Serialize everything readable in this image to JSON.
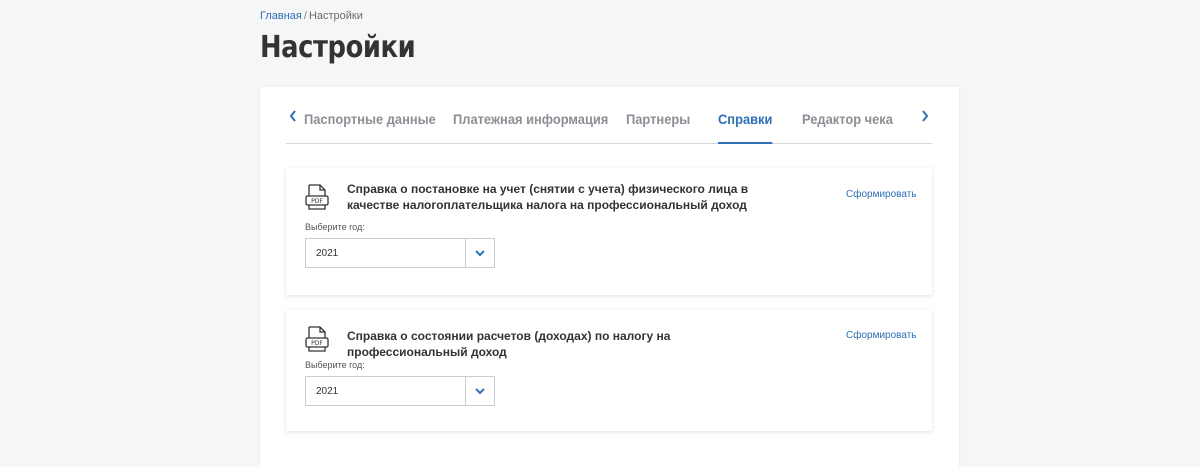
{
  "breadcrumb": {
    "home": "Главная",
    "separator": "/",
    "current": "Настройки"
  },
  "page": {
    "title": "Настройки"
  },
  "tabs": {
    "prev_icon": "chevron-left-icon",
    "next_icon": "chevron-right-icon",
    "items": [
      {
        "label": "Паспортные данные",
        "active": false
      },
      {
        "label": "Платежная информация",
        "active": false
      },
      {
        "label": "Партнеры",
        "active": false
      },
      {
        "label": "Справки",
        "active": true
      },
      {
        "label": "Редактор чека",
        "active": false
      }
    ]
  },
  "cards": [
    {
      "icon": "pdf-icon",
      "title": "Справка о постановке на учет (снятии с учета) физического лица в качестве налогоплательщика налога на профессиональный доход",
      "action": "Сформировать",
      "year_label": "Выберите год:",
      "year_value": "2021"
    },
    {
      "icon": "pdf-icon",
      "title": "Справка о состоянии расчетов (доходах) по налогу на профессиональный доход",
      "action": "Сформировать",
      "year_label": "Выберите год:",
      "year_value": "2021"
    }
  ],
  "colors": {
    "accent": "#2f6fb5",
    "background": "#f5f6f8",
    "muted": "#8a8f96"
  }
}
